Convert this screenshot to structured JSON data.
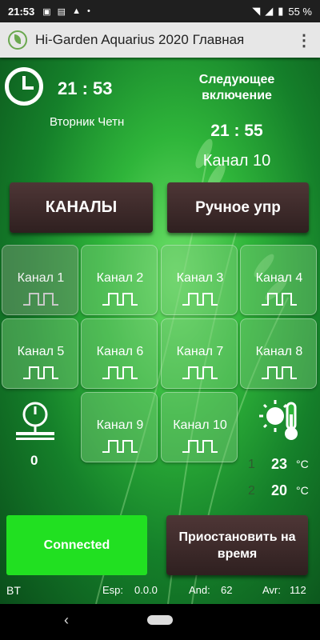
{
  "status_bar": {
    "time": "21:53",
    "battery": "55 %",
    "icons": [
      "image-icon",
      "news-icon",
      "drive-icon",
      "dot-icon",
      "wifi-icon",
      "signal-icon",
      "battery-icon"
    ]
  },
  "app_bar": {
    "title": "Hi-Garden Aquarius 2020 Главная",
    "menu_icon": "more-vert-icon"
  },
  "clock": {
    "time": "21 : 53",
    "weekday": "Вторник Четн"
  },
  "next_run": {
    "label": "Следующее включение",
    "time": "21 : 55",
    "channel": "Канал 10"
  },
  "buttons": {
    "channels": "КАНАЛЫ",
    "manual": "Ручное упр",
    "pause": "Приостановить на время"
  },
  "channels": [
    {
      "label": "Канал 1",
      "active": false
    },
    {
      "label": "Канал 2",
      "active": true
    },
    {
      "label": "Канал 3",
      "active": true
    },
    {
      "label": "Канал 4",
      "active": true
    },
    {
      "label": "Канал 5",
      "active": true
    },
    {
      "label": "Канал 6",
      "active": true
    },
    {
      "label": "Канал 7",
      "active": true
    },
    {
      "label": "Канал 8",
      "active": true
    },
    {
      "label": "Канал 9",
      "active": true
    },
    {
      "label": "Канал 10",
      "active": true
    }
  ],
  "pressure": {
    "value": "0"
  },
  "temperatures": [
    {
      "index": "1",
      "value": "23",
      "unit": "°C"
    },
    {
      "index": "2",
      "value": "20",
      "unit": "°C"
    }
  ],
  "connection": {
    "status": "Connected"
  },
  "footer": {
    "bt": "BT",
    "esp_label": "Esp:",
    "esp_value": "0.0.0",
    "and_label": "And:",
    "and_value": "62",
    "avr_label": "Avr:",
    "avr_value": "112"
  },
  "colors": {
    "connected": "#21e021",
    "dark_button": "#3a2828",
    "background": "#2fb53a"
  }
}
